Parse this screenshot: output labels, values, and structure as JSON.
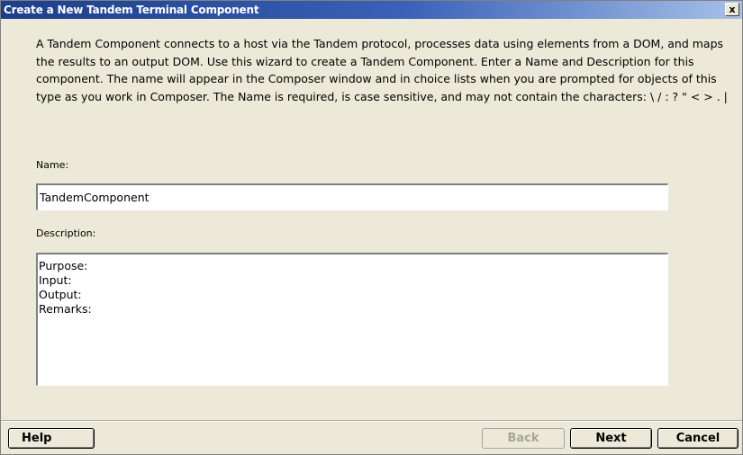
{
  "window": {
    "title": "Create a New Tandem Terminal Component",
    "close_glyph": "x"
  },
  "intro": {
    "text": "A Tandem Component connects to a host via the Tandem protocol, processes data using elements from a DOM, and maps the results to an output DOM.  Use this wizard to create a Tandem Component.  Enter a Name and Description for this component.  The name will appear in the Composer window and in choice lists when you are prompted for objects of this type as you work in Composer.  The Name is required, is case sensitive, and may not contain the characters: \\ / : ? \" < > . |"
  },
  "name_field": {
    "label": "Name:",
    "value": "TandemComponent"
  },
  "description_field": {
    "label": "Description:",
    "value": "Purpose:\nInput:\nOutput:\nRemarks:"
  },
  "buttons": {
    "help": "Help",
    "back": "Back",
    "next": "Next",
    "cancel": "Cancel"
  },
  "button_states": {
    "back_enabled": false
  },
  "colors": {
    "titlebar_start": "#1c3e8c",
    "titlebar_end": "#a6c0e8",
    "dialog_background": "#ece9d8",
    "disabled_text": "#a7a59a"
  }
}
